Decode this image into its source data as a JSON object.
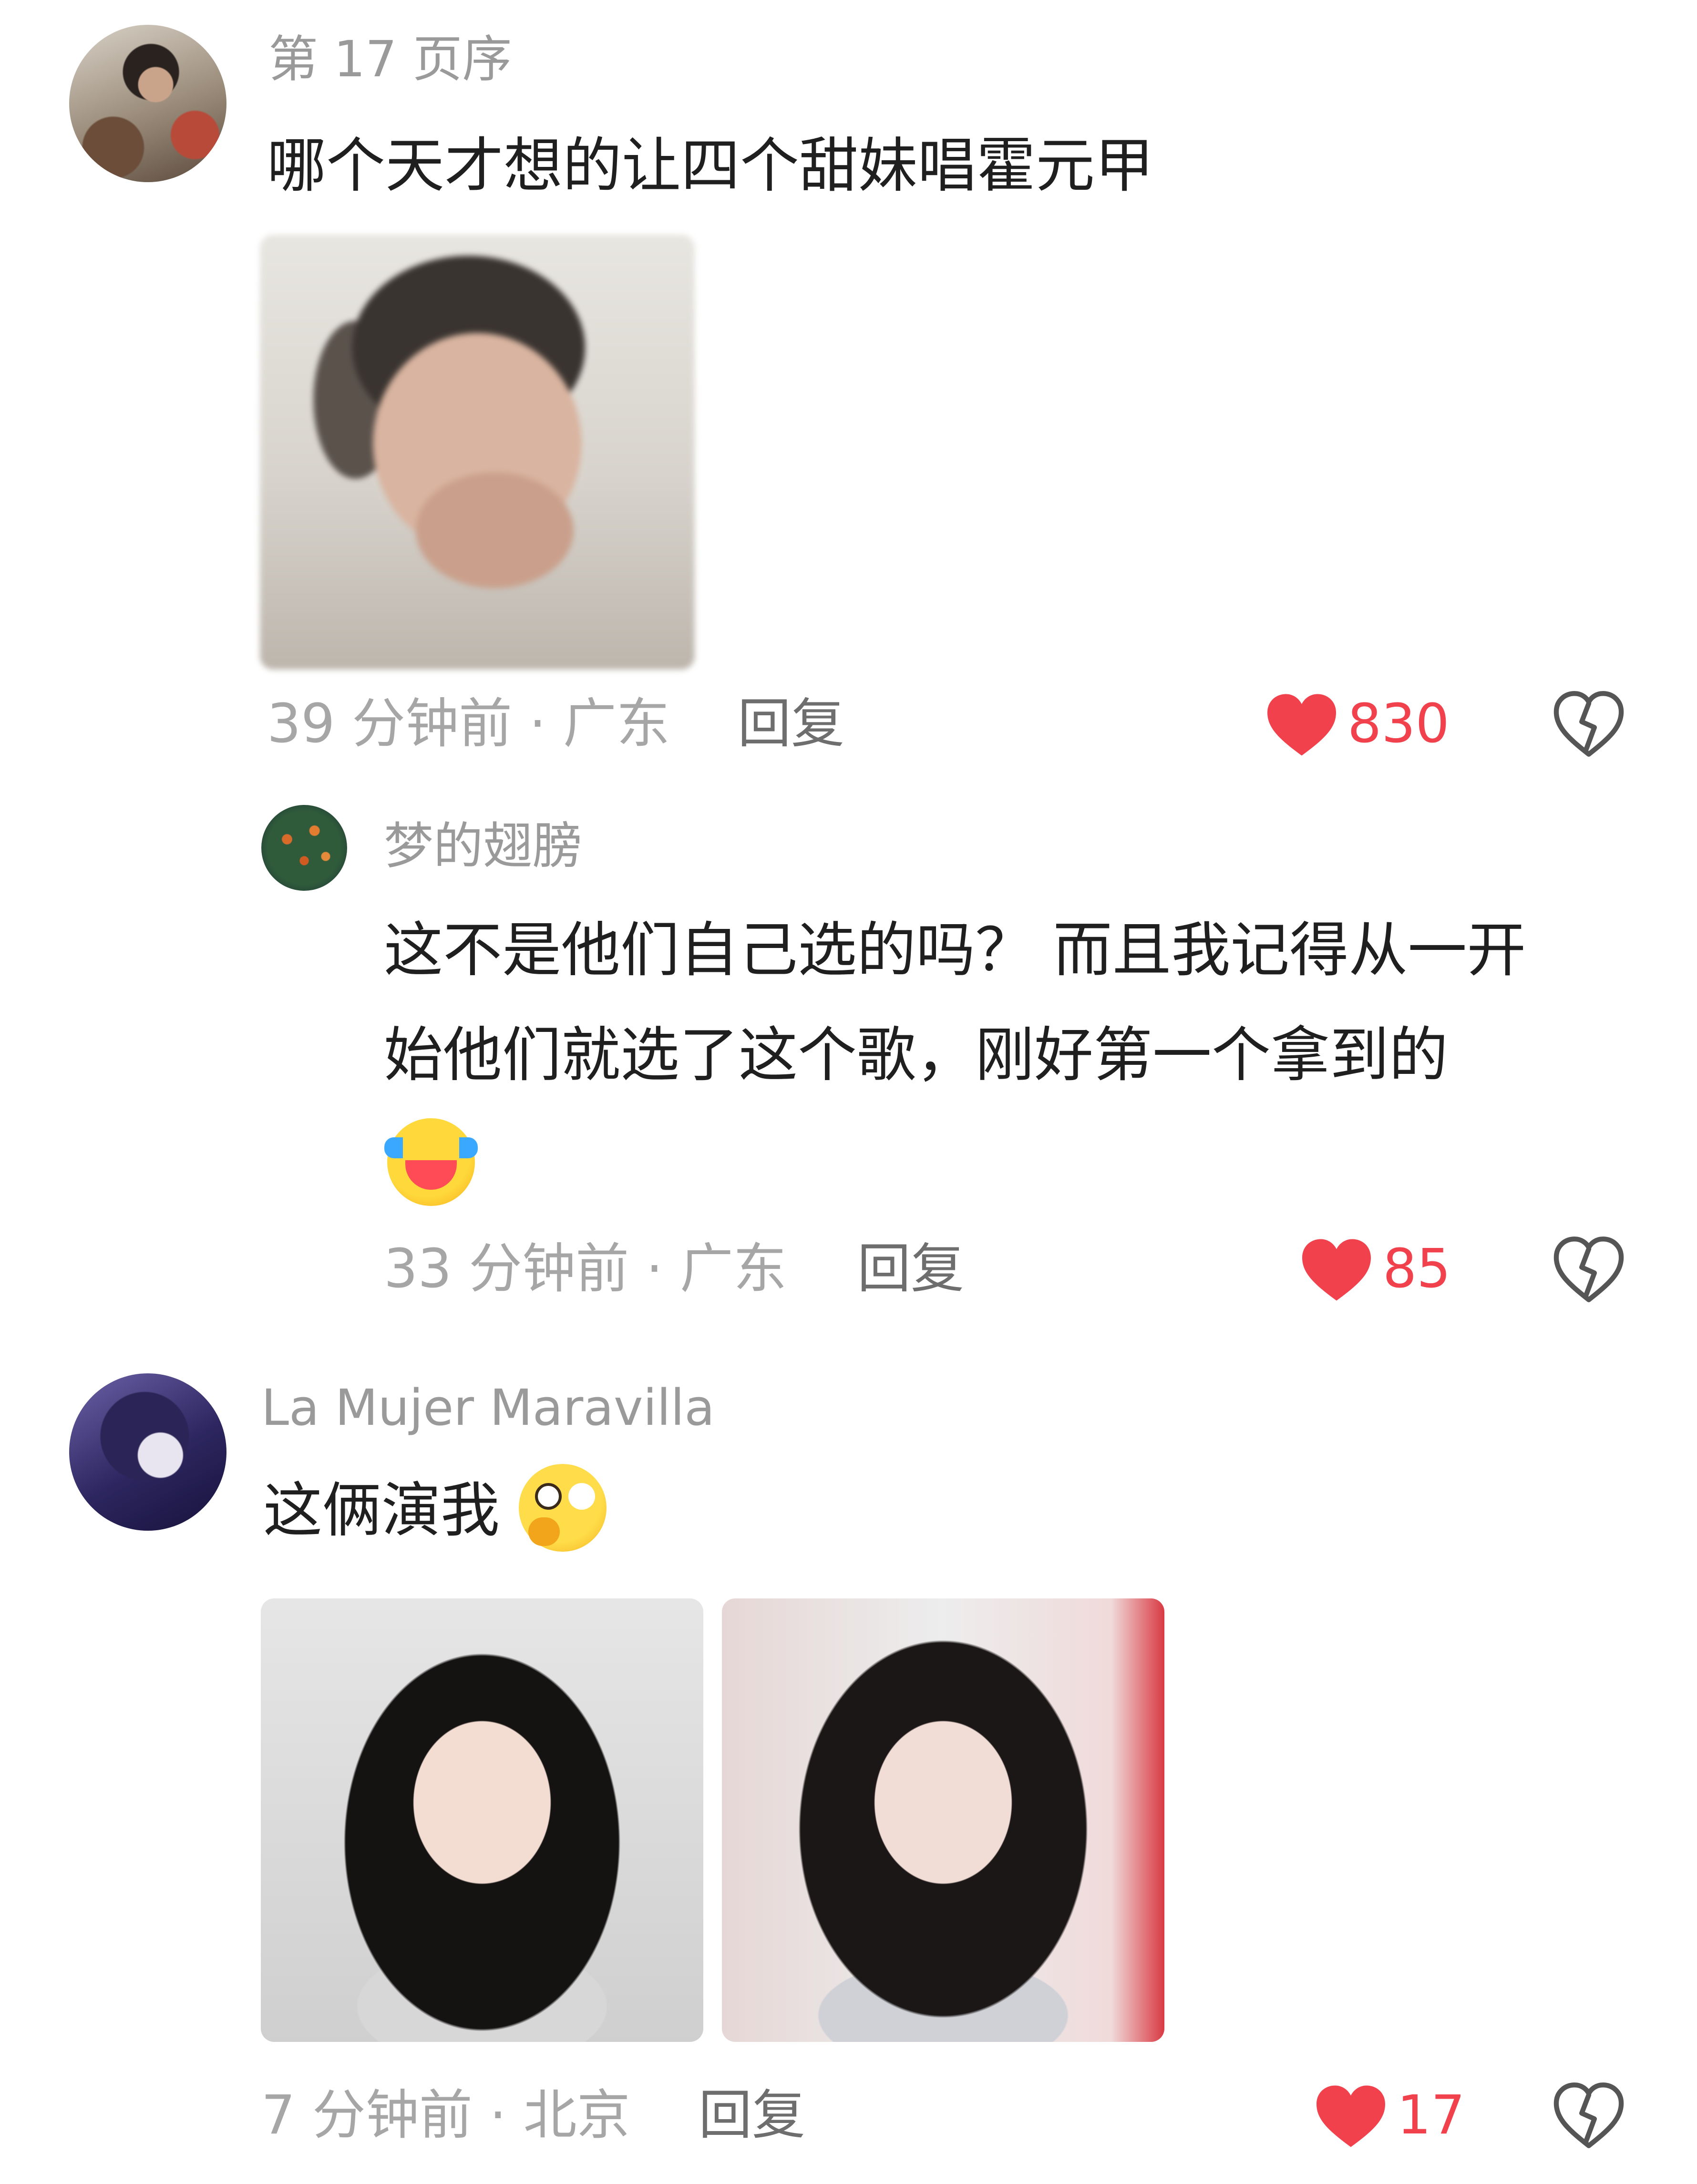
{
  "comments": [
    {
      "username": "第 17 页序",
      "text": "哪个天才想的让四个甜妹唱霍元甲",
      "meta": "39 分钟前 · 广东",
      "reply_label": "回复",
      "likes": "830"
    },
    {
      "username": "梦的翅膀",
      "text_line1": "这不是他们自己选的吗？ 而且我记得从一开",
      "text_line2": "始他们就选了这个歌，刚好第一个拿到的",
      "emoji": "laughing-tears-emoji",
      "meta": "33 分钟前 · 广东",
      "reply_label": "回复",
      "likes": "85"
    },
    {
      "username": "La Mujer Maravilla",
      "text": "这俩演我",
      "emoji": "thinking-face-emoji",
      "meta": "7 分钟前 · 北京",
      "reply_label": "回复",
      "likes": "17"
    }
  ],
  "colors": {
    "like_red": "#f1414d",
    "meta_gray": "#a6a6a6",
    "username_gray": "#9a9a9a",
    "text": "#1f1f1f"
  }
}
